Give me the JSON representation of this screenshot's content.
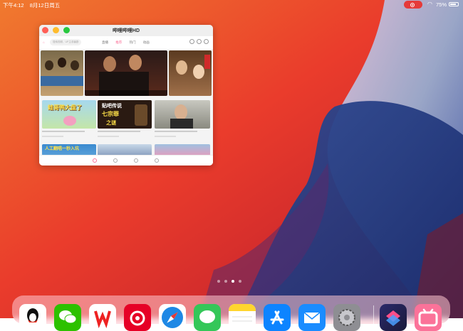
{
  "status_bar": {
    "time": "下午4:12",
    "date": "8月12日周五",
    "battery": "75%"
  },
  "app_window": {
    "title": "哔哩哔哩HD",
    "search_placeholder": "搜索视频、UP主或番剧",
    "tabs": [
      "直播",
      "推荐",
      "热门",
      "动画"
    ],
    "active_tab": "推荐"
  },
  "videos": {
    "card1_title": "蛙哥鸭大盘了",
    "card2_title": "贴吧传说",
    "card2_subtitle": "七宗罪",
    "card2_footer": "之谜",
    "card3_banner": "人工翻唱一秒入坑"
  },
  "dock": {
    "apps": [
      "QQ",
      "微信",
      "WPS Office",
      "网易云音乐",
      "Safari",
      "信息",
      "备忘录",
      "App Store",
      "邮件",
      "设置",
      "快捷指令",
      "哔哩哔哩"
    ]
  },
  "colors": {
    "accent": "#fb7299",
    "record_indicator": "#e53a3a"
  }
}
